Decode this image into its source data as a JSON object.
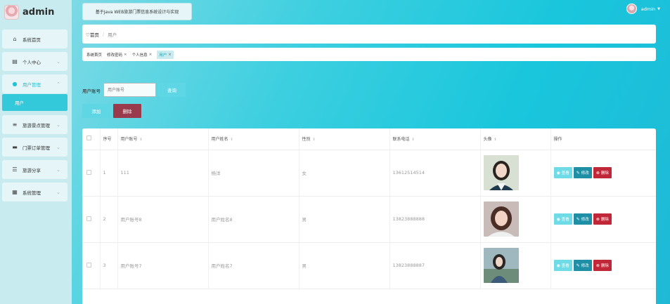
{
  "brand": {
    "title": "admin"
  },
  "sidebar": {
    "items": [
      {
        "label": "系统首页",
        "icon": "home-icon"
      },
      {
        "label": "个人中心",
        "icon": "id-card-icon"
      },
      {
        "label": "用户管理",
        "icon": "user-group-icon"
      },
      {
        "label": "旅游景点管理",
        "icon": "list-icon"
      },
      {
        "label": "门票订单管理",
        "icon": "ticket-icon"
      },
      {
        "label": "旅游分享",
        "icon": "sliders-icon"
      },
      {
        "label": "系统管理",
        "icon": "grid-icon"
      }
    ],
    "sub_item": "用户"
  },
  "header": {
    "system_title": "基于Java WEB旅游门票信息系统设计与实现",
    "user_name": "admin"
  },
  "breadcrumb": {
    "home": "首页",
    "current": "用户"
  },
  "tags": [
    {
      "label": "系统首页",
      "closable": false
    },
    {
      "label": "修改密码",
      "closable": true
    },
    {
      "label": "个人信息",
      "closable": true
    },
    {
      "label": "用户",
      "closable": true
    }
  ],
  "search": {
    "label": "用户账号",
    "placeholder": "用户账号",
    "button": "查询"
  },
  "actions": {
    "add": "添加",
    "delete": "删除"
  },
  "table": {
    "headers": [
      "序号",
      "用户账号",
      "用户姓名",
      "性别",
      "联系电话",
      "头像",
      "操作"
    ],
    "rows": [
      {
        "index": "1",
        "account": "111",
        "name": "杨洋",
        "gender": "女",
        "phone": "13612514514"
      },
      {
        "index": "2",
        "account": "用户账号8",
        "name": "用户姓名8",
        "gender": "男",
        "phone": "13823888888"
      },
      {
        "index": "3",
        "account": "用户账号7",
        "name": "用户姓名7",
        "gender": "男",
        "phone": "13823888887"
      }
    ],
    "op_labels": {
      "view": "查看",
      "edit": "修改",
      "delete": "删除"
    }
  },
  "colors": {
    "accent": "#33c8da",
    "delete": "#c0283a",
    "edit": "#1f8fa6",
    "sidebar_bg": "#c8ebef"
  }
}
